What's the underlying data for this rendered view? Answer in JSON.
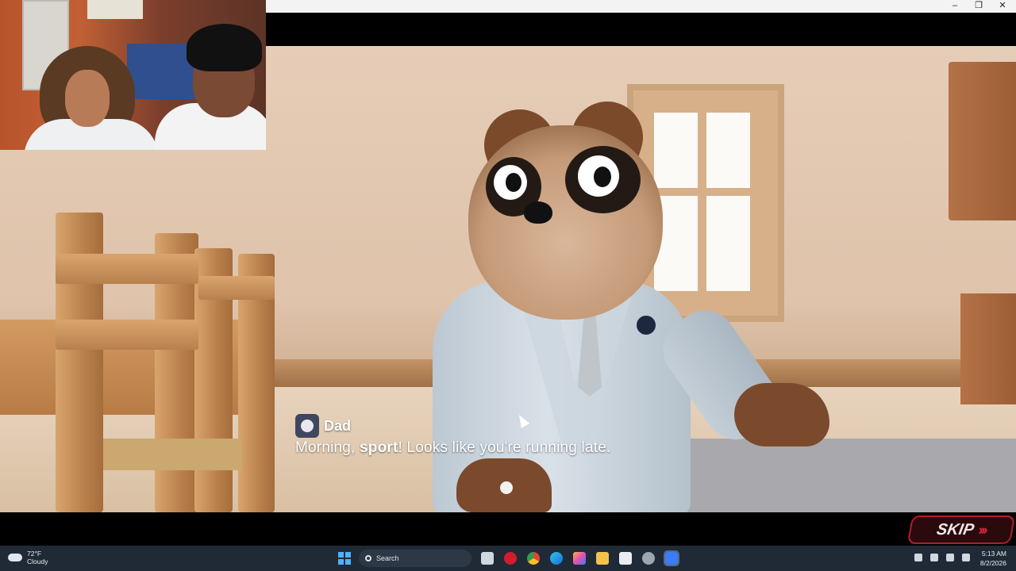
{
  "window_controls": {
    "minimize": "–",
    "maximize": "❐",
    "close": "✕"
  },
  "dialog": {
    "speaker": "Dad",
    "line_before": "Morning, ",
    "line_bold": "sport",
    "line_after": "! Looks like you're running late."
  },
  "skip": {
    "label": "SKIP",
    "arrows": "›››"
  },
  "taskbar": {
    "weather_temp": "72°F",
    "weather_desc": "Cloudy",
    "search_placeholder": "Search",
    "time": "5:13 AM",
    "date": "8/2/2026"
  },
  "icons": [
    "cloud-icon",
    "windows-start-icon",
    "search-icon",
    "task-view-icon",
    "opera-icon",
    "chrome-icon",
    "edge-icon",
    "copilot-icon",
    "file-explorer-icon",
    "microsoft-store-icon",
    "app-icon",
    "roblox-icon",
    "chevron-up-icon",
    "microphone-icon",
    "wifi-icon",
    "speaker-icon"
  ],
  "colors": {
    "skip_border": "#b01e2a",
    "taskbar_bg": "#1f2a36",
    "start_blue": "#4fb0ff"
  }
}
